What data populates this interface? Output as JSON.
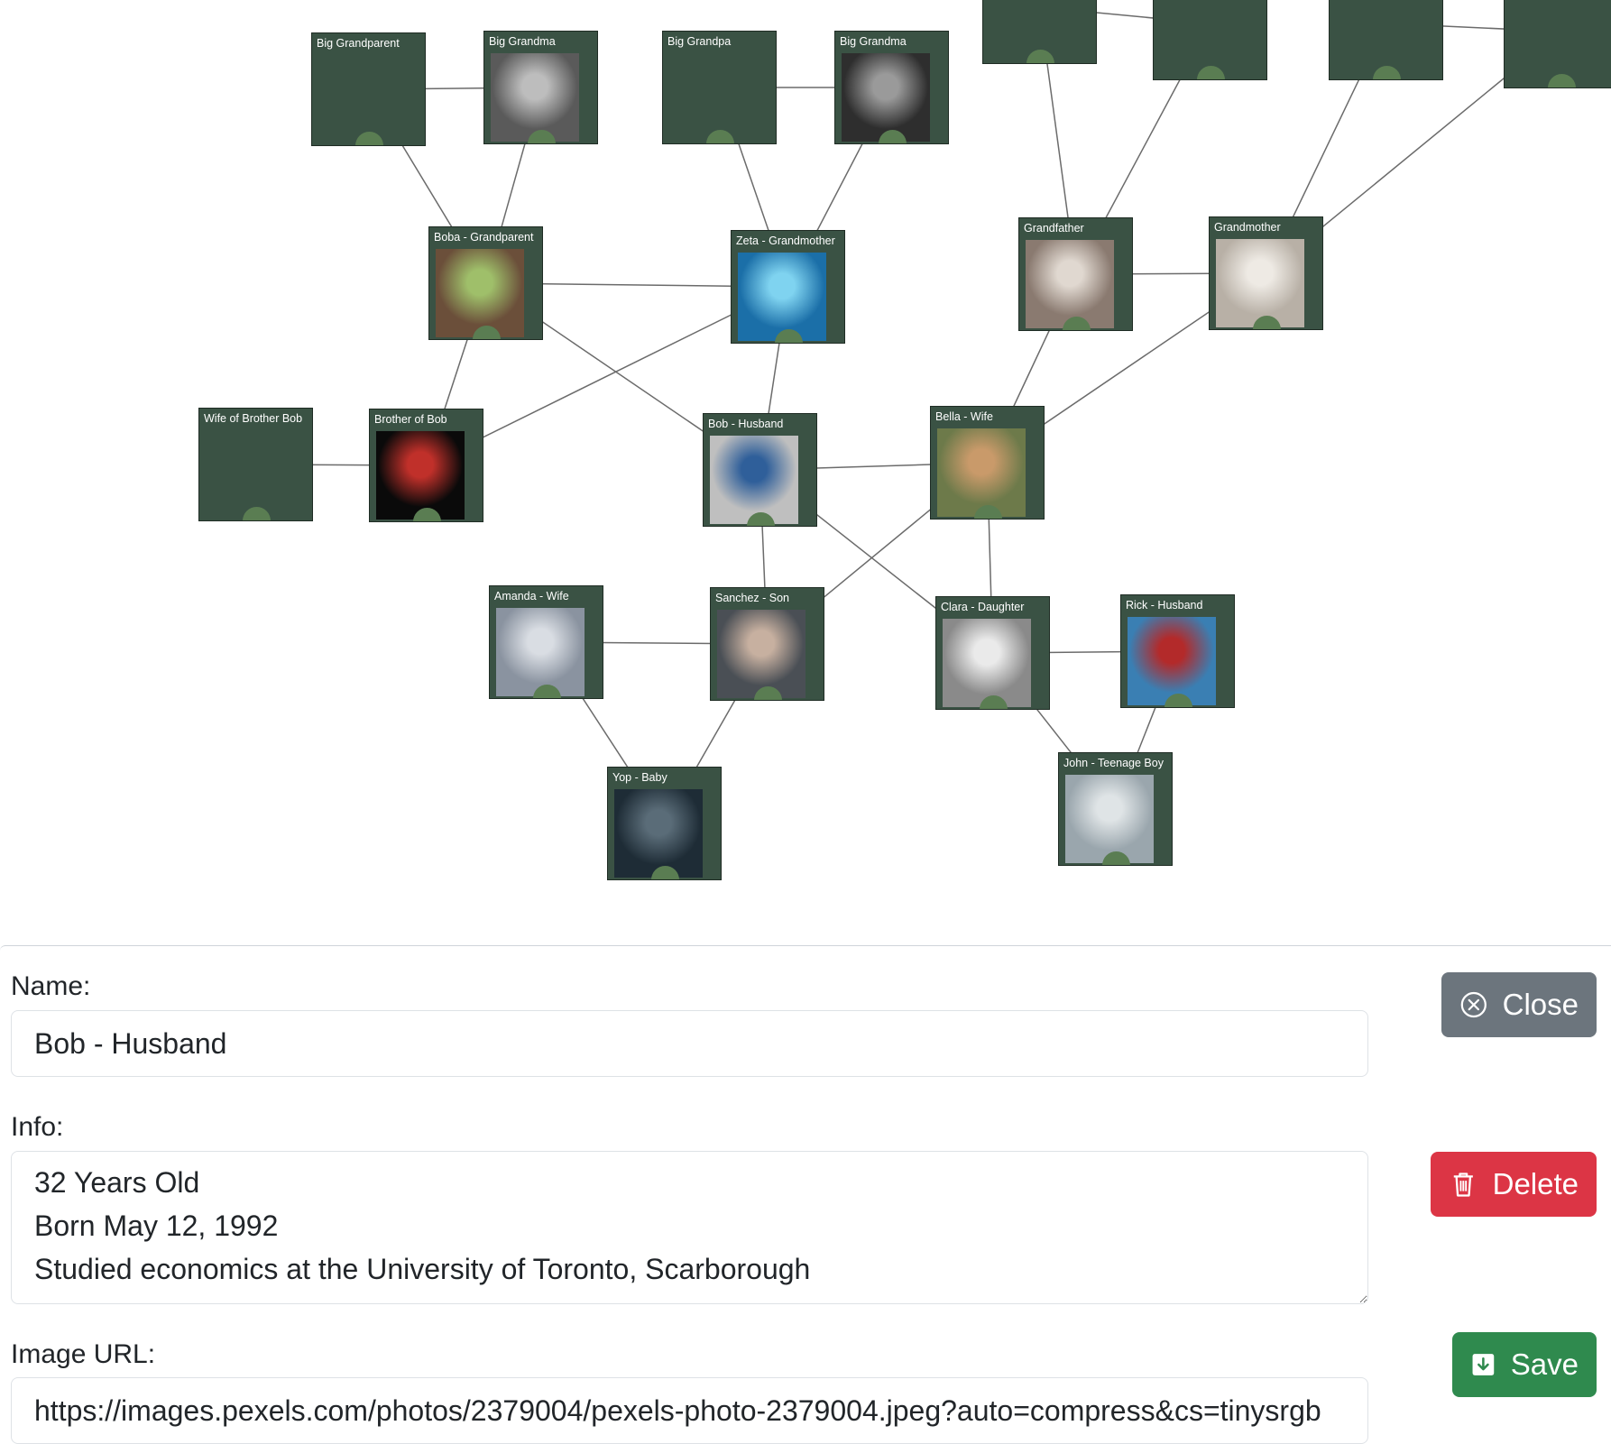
{
  "tree": {
    "nodes": [
      {
        "id": "n1",
        "label": "Big Grandparent",
        "photo": false
      },
      {
        "id": "n2",
        "label": "Big Grandma",
        "photo": true,
        "tone": [
          "#5a5a5a",
          "#bdbdbd"
        ]
      },
      {
        "id": "n3",
        "label": "Big Grandpa",
        "photo": false
      },
      {
        "id": "n4",
        "label": "Big Grandma",
        "photo": true,
        "tone": [
          "#2e2e2e",
          "#9a9a9a"
        ]
      },
      {
        "id": "t1",
        "label": "",
        "photo": false
      },
      {
        "id": "t2",
        "label": "",
        "photo": false
      },
      {
        "id": "t3",
        "label": "",
        "photo": false
      },
      {
        "id": "t4",
        "label": "",
        "photo": false
      },
      {
        "id": "n5",
        "label": "Boba - Grandparent",
        "photo": true,
        "tone": [
          "#6b4f3a",
          "#9fbf6a"
        ]
      },
      {
        "id": "n6",
        "label": "Zeta - Grandmother",
        "photo": true,
        "tone": [
          "#1b6fa8",
          "#7fd3f0"
        ]
      },
      {
        "id": "n7",
        "label": "Grandfather",
        "photo": true,
        "tone": [
          "#8a7a70",
          "#e0d8d0"
        ]
      },
      {
        "id": "n8",
        "label": "Grandmother",
        "photo": true,
        "tone": [
          "#b8b0a6",
          "#eeeae4"
        ]
      },
      {
        "id": "n9",
        "label": "Wife of Brother Bob",
        "photo": false
      },
      {
        "id": "n10",
        "label": "Brother of Bob",
        "photo": true,
        "tone": [
          "#0a0a0a",
          "#c0302a"
        ]
      },
      {
        "id": "n11",
        "label": "Bob - Husband",
        "photo": true,
        "tone": [
          "#bfbfbf",
          "#2f5f9a"
        ]
      },
      {
        "id": "n12",
        "label": "Bella - Wife",
        "photo": true,
        "tone": [
          "#6d7a4a",
          "#c99a6a"
        ]
      },
      {
        "id": "n13",
        "label": "Amanda - Wife",
        "photo": true,
        "tone": [
          "#8a93a0",
          "#d9dde3"
        ]
      },
      {
        "id": "n14",
        "label": "Sanchez - Son",
        "photo": true,
        "tone": [
          "#4a4f55",
          "#c7b0a0"
        ]
      },
      {
        "id": "n15",
        "label": "Clara - Daughter",
        "photo": true,
        "tone": [
          "#8a8a8a",
          "#eaeaea"
        ]
      },
      {
        "id": "n16",
        "label": "Rick - Husband",
        "photo": true,
        "tone": [
          "#3a7fb3",
          "#b32a2a"
        ]
      },
      {
        "id": "n17",
        "label": "Yop - Baby",
        "photo": true,
        "tone": [
          "#1e2c36",
          "#5a6c78"
        ]
      },
      {
        "id": "n18",
        "label": "John - Teenage Boy",
        "photo": true,
        "tone": [
          "#9aa6ad",
          "#dfe4e6"
        ]
      }
    ],
    "links": [
      [
        "n1",
        "n2"
      ],
      [
        "n3",
        "n4"
      ],
      [
        "t1",
        "t2"
      ],
      [
        "t3",
        "t4"
      ],
      [
        "n1",
        "n5"
      ],
      [
        "n2",
        "n5"
      ],
      [
        "n3",
        "n6"
      ],
      [
        "n4",
        "n6"
      ],
      [
        "t1",
        "n7"
      ],
      [
        "t2",
        "n7"
      ],
      [
        "t3",
        "n8"
      ],
      [
        "t4",
        "n8"
      ],
      [
        "n5",
        "n6"
      ],
      [
        "n7",
        "n8"
      ],
      [
        "n5",
        "n10"
      ],
      [
        "n6",
        "n10"
      ],
      [
        "n5",
        "n11"
      ],
      [
        "n6",
        "n11"
      ],
      [
        "n7",
        "n12"
      ],
      [
        "n8",
        "n12"
      ],
      [
        "n9",
        "n10"
      ],
      [
        "n11",
        "n12"
      ],
      [
        "n11",
        "n14"
      ],
      [
        "n12",
        "n14"
      ],
      [
        "n11",
        "n15"
      ],
      [
        "n12",
        "n15"
      ],
      [
        "n13",
        "n14"
      ],
      [
        "n15",
        "n16"
      ],
      [
        "n13",
        "n17"
      ],
      [
        "n14",
        "n17"
      ],
      [
        "n15",
        "n18"
      ],
      [
        "n16",
        "n18"
      ]
    ],
    "colors": {
      "node_bg": "#3a5244",
      "dot": "#5a7d52",
      "edge": "#6b6b6b"
    }
  },
  "form": {
    "name_label": "Name:",
    "name_value": "Bob - Husband",
    "info_label": "Info:",
    "info_value": "32 Years Old\nBorn May 12, 1992\nStudied economics at the University of Toronto, Scarborough",
    "url_label": "Image URL:",
    "url_value": "https://images.pexels.com/photos/2379004/pexels-photo-2379004.jpeg?auto=compress&cs=tinysrgb"
  },
  "buttons": {
    "close_label": "Close",
    "delete_label": "Delete",
    "save_label": "Save",
    "close_color": "#6c757d",
    "delete_color": "#dc3545",
    "save_color": "#2f8a4e"
  },
  "icons": {
    "close": "x-circle-icon",
    "delete": "trash-icon",
    "save": "download-icon"
  }
}
